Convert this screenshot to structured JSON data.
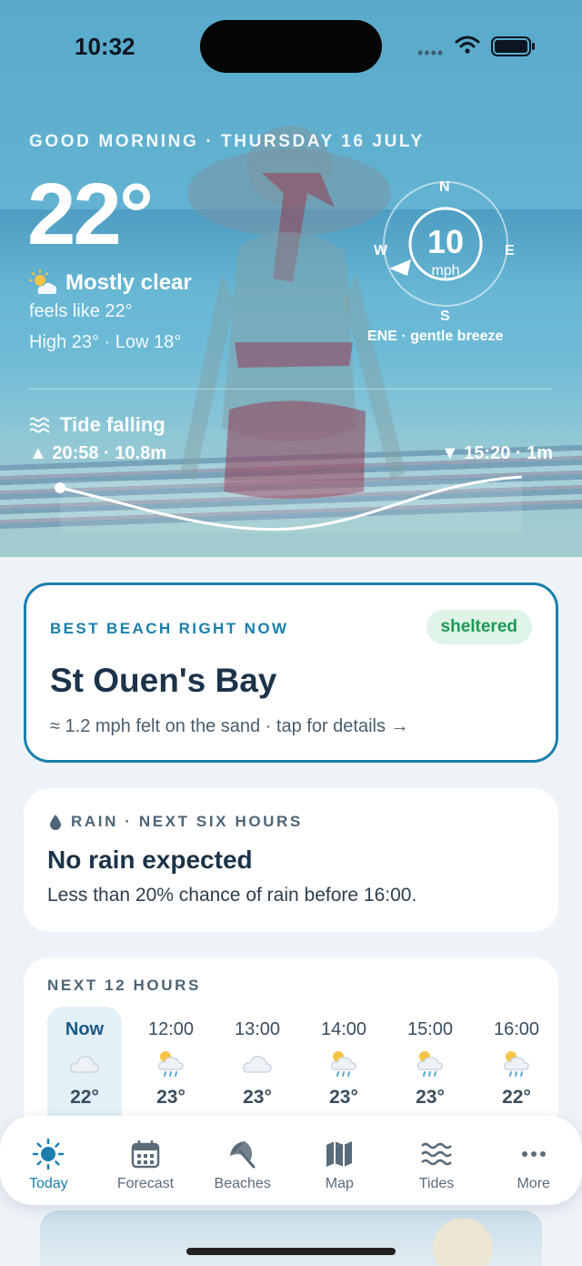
{
  "status_bar": {
    "time": "10:32",
    "signal": "••••"
  },
  "hero": {
    "greeting": "GOOD MORNING · THURSDAY 16 JULY",
    "temperature": "22°",
    "condition": "Mostly clear",
    "condition_icon": "partly-sunny-icon",
    "feels_like": "feels like 22°",
    "high_low": "High 23° · Low 18°",
    "wind": {
      "speed": "10",
      "unit": "mph",
      "n": "N",
      "e": "E",
      "s": "S",
      "w": "W",
      "description": "ENE · gentle breeze"
    },
    "tide": {
      "title": "Tide falling",
      "high": "▲ 20:58 · 10.8m",
      "low": "▼ 15:20 · 1m"
    }
  },
  "best_beach": {
    "label": "BEST BEACH RIGHT NOW",
    "badge": "sheltered",
    "name": "St Ouen's Bay",
    "subtitle": "≈ 1.2 mph felt on the sand · tap for details →"
  },
  "rain": {
    "label": "RAIN · NEXT SIX HOURS",
    "title": "No rain expected",
    "subtitle": "Less than 20% chance of rain before 16:00."
  },
  "hourly": {
    "label": "NEXT 12 HOURS",
    "items": [
      {
        "time": "Now",
        "icon": "cloud-icon",
        "temp": "22°"
      },
      {
        "time": "12:00",
        "icon": "sun-rain-icon",
        "temp": "23°"
      },
      {
        "time": "13:00",
        "icon": "cloud-icon",
        "temp": "23°"
      },
      {
        "time": "14:00",
        "icon": "sun-rain-icon",
        "temp": "23°"
      },
      {
        "time": "15:00",
        "icon": "sun-rain-icon",
        "temp": "23°"
      },
      {
        "time": "16:00",
        "icon": "sun-rain-icon",
        "temp": "22°"
      }
    ]
  },
  "tabs": [
    {
      "label": "Today",
      "icon": "sun-icon",
      "active": true
    },
    {
      "label": "Forecast",
      "icon": "calendar-icon",
      "active": false
    },
    {
      "label": "Beaches",
      "icon": "umbrella-icon",
      "active": false
    },
    {
      "label": "Map",
      "icon": "map-icon",
      "active": false
    },
    {
      "label": "Tides",
      "icon": "waves-icon",
      "active": false
    },
    {
      "label": "More",
      "icon": "more-icon",
      "active": false
    }
  ],
  "colors": {
    "accent": "#1a7fad",
    "badge_bg": "#e0f3e8",
    "badge_text": "#1e9a55",
    "hero_top": "#59aacb"
  }
}
